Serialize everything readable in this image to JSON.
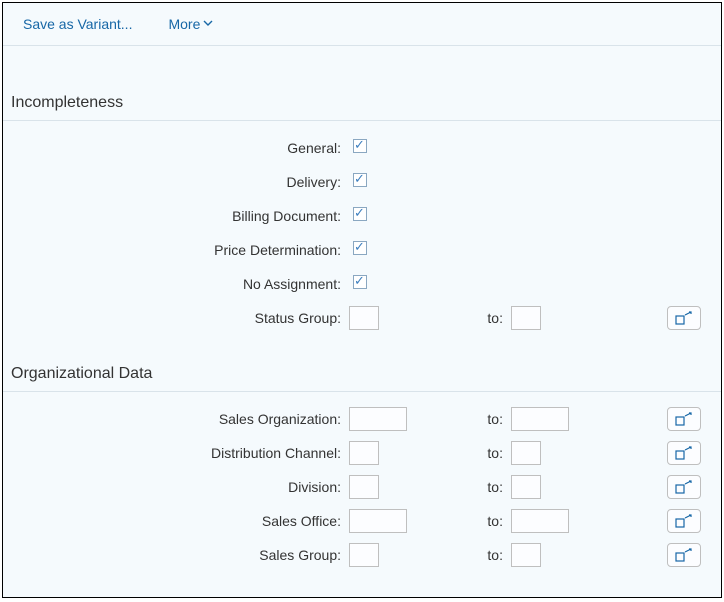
{
  "toolbar": {
    "save_as_variant_label": "Save as Variant...",
    "more_label": "More"
  },
  "sections": {
    "incompleteness": {
      "title": "Incompleteness",
      "general_label": "General:",
      "general_checked": true,
      "delivery_label": "Delivery:",
      "delivery_checked": true,
      "billing_label": "Billing Document:",
      "billing_checked": true,
      "pricedet_label": "Price Determination:",
      "pricedet_checked": true,
      "noassign_label": "No Assignment:",
      "noassign_checked": true,
      "status_group_label": "Status Group:",
      "to_label": "to:"
    },
    "orgdata": {
      "title": "Organizational Data",
      "sales_org_label": "Sales Organization:",
      "dist_channel_label": "Distribution Channel:",
      "division_label": "Division:",
      "sales_office_label": "Sales Office:",
      "sales_group_label": "Sales Group:",
      "to_label": "to:"
    }
  }
}
